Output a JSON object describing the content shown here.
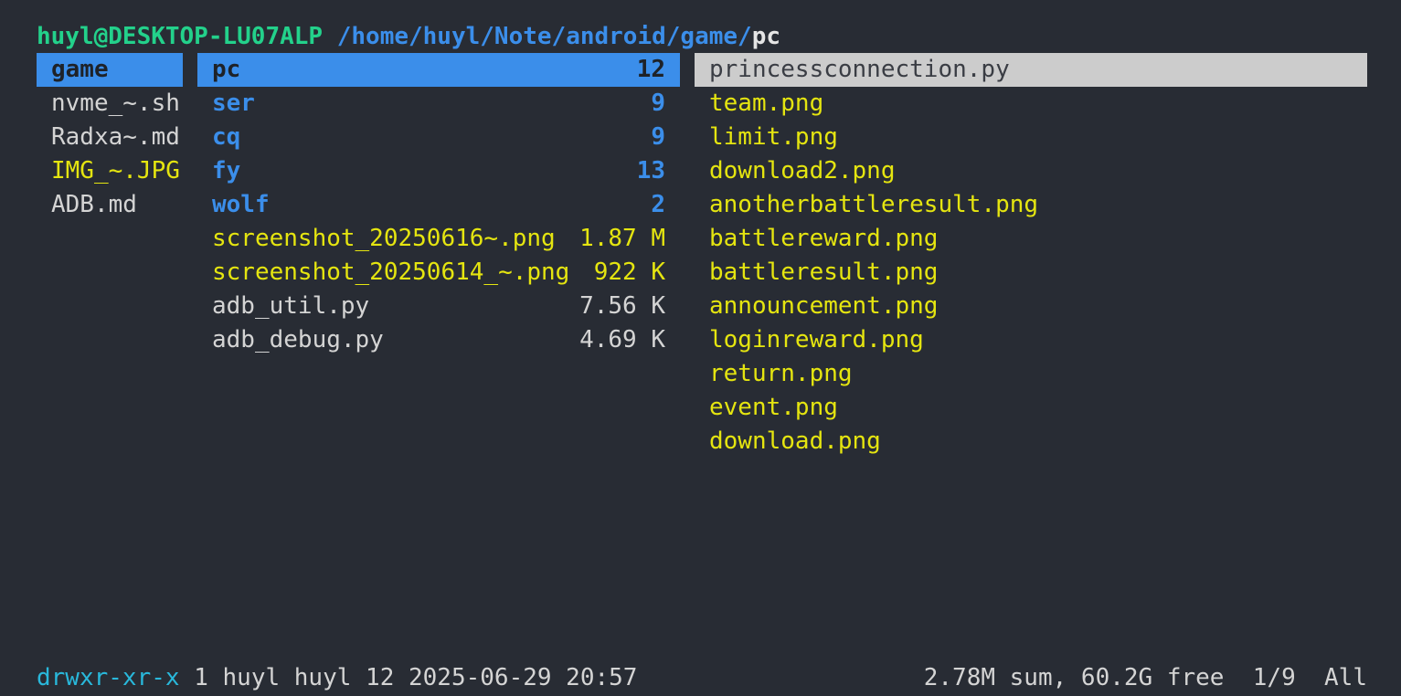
{
  "title": {
    "user_host": "huyl@DESKTOP-LU07ALP",
    "path": "/home/huyl/Note/android/game/",
    "current": "pc"
  },
  "parent_column": [
    {
      "name": "game",
      "kind": "dir",
      "selected": true
    },
    {
      "name": "nvme_~.sh",
      "kind": "file"
    },
    {
      "name": "Radxa~.md",
      "kind": "file"
    },
    {
      "name": "IMG_~.JPG",
      "kind": "media"
    },
    {
      "name": "ADB.md",
      "kind": "file"
    }
  ],
  "current_column": [
    {
      "name": "pc",
      "info": "12",
      "kind": "dir",
      "selected": true
    },
    {
      "name": "ser",
      "info": "9",
      "kind": "dir"
    },
    {
      "name": "cq",
      "info": "9",
      "kind": "dir"
    },
    {
      "name": "fy",
      "info": "13",
      "kind": "dir"
    },
    {
      "name": "wolf",
      "info": "2",
      "kind": "dir"
    },
    {
      "name": "screenshot_20250616~.png",
      "info": "1.87 M",
      "kind": "media"
    },
    {
      "name": "screenshot_20250614_~.png",
      "info": "922 K",
      "kind": "media"
    },
    {
      "name": "adb_util.py",
      "info": "7.56 K",
      "kind": "file"
    },
    {
      "name": "adb_debug.py",
      "info": "4.69 K",
      "kind": "file"
    }
  ],
  "preview_column": [
    {
      "name": "princessconnection.py",
      "kind": "file",
      "selected": true
    },
    {
      "name": "team.png",
      "kind": "media"
    },
    {
      "name": "limit.png",
      "kind": "media"
    },
    {
      "name": "download2.png",
      "kind": "media"
    },
    {
      "name": "anotherbattleresult.png",
      "kind": "media"
    },
    {
      "name": "battlereward.png",
      "kind": "media"
    },
    {
      "name": "battleresult.png",
      "kind": "media"
    },
    {
      "name": "announcement.png",
      "kind": "media"
    },
    {
      "name": "loginreward.png",
      "kind": "media"
    },
    {
      "name": "return.png",
      "kind": "media"
    },
    {
      "name": "event.png",
      "kind": "media"
    },
    {
      "name": "download.png",
      "kind": "media"
    }
  ],
  "status": {
    "permissions": "drwxr-xr-x",
    "details": " 1 huyl huyl 12 2025-06-29 20:57",
    "right": "2.78M sum, 60.2G free  1/9  All"
  },
  "colors": {
    "background": "#282c34",
    "directory": "#3b8eea",
    "media": "#e5e510",
    "user_host": "#23d18b",
    "selection": "#3b8eea",
    "preview_selection": "#cccccc"
  }
}
